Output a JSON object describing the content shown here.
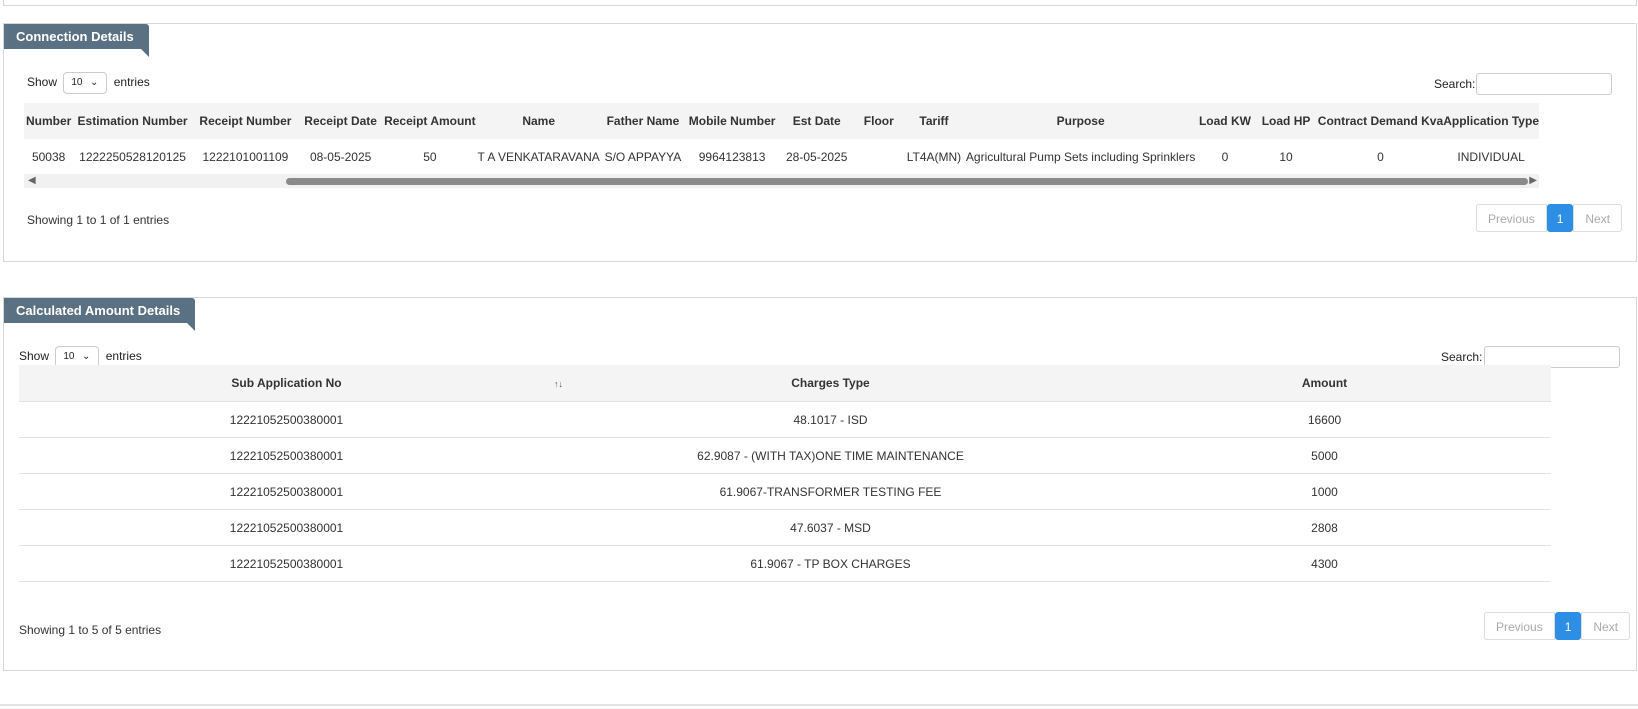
{
  "connection": {
    "title": "Connection Details",
    "show_label": "Show",
    "entries_label": "entries",
    "length_value": "10",
    "search_label": "Search:",
    "columns": [
      "Number",
      "Estimation Number",
      "Receipt Number",
      "Receipt Date",
      "Receipt Amount",
      "Name",
      "Father Name",
      "Mobile Number",
      "Est Date",
      "Floor",
      "Tariff",
      "Purpose",
      "Load KW",
      "Load HP",
      "Contract Demand Kva",
      "Application Type"
    ],
    "rows": [
      [
        "50038",
        "1222250528120125",
        "1222101001109",
        "08-05-2025",
        "50",
        "T A VENKATARAVANA",
        "S/O APPAYYA",
        "9964123813",
        "28-05-2025",
        "",
        "LT4A(MN)",
        "Agricultural Pump Sets including Sprinklers",
        "0",
        "10",
        "0",
        "INDIVIDUAL"
      ]
    ],
    "info": "Showing 1 to 1 of 1 entries",
    "pager": {
      "previous": "Previous",
      "page": "1",
      "next": "Next"
    }
  },
  "calculated": {
    "title": "Calculated Amount Details",
    "show_label": "Show",
    "entries_label": "entries",
    "length_value": "10",
    "search_label": "Search:",
    "columns": [
      "Sub Application No",
      "",
      "Charges Type",
      "Amount"
    ],
    "sort_icon": "↑↓",
    "rows": [
      [
        "12221052500380001",
        "",
        "48.1017 - ISD",
        "16600"
      ],
      [
        "12221052500380001",
        "",
        "62.9087 - (WITH TAX)ONE TIME MAINTENANCE",
        "5000"
      ],
      [
        "12221052500380001",
        "",
        "61.9067-TRANSFORMER TESTING FEE",
        "1000"
      ],
      [
        "12221052500380001",
        "",
        "47.6037 - MSD",
        "2808"
      ],
      [
        "12221052500380001",
        "",
        "61.9067 - TP BOX CHARGES",
        "4300"
      ]
    ],
    "info": "Showing 1 to 5 of 5 entries",
    "pager": {
      "previous": "Previous",
      "page": "1",
      "next": "Next"
    }
  }
}
